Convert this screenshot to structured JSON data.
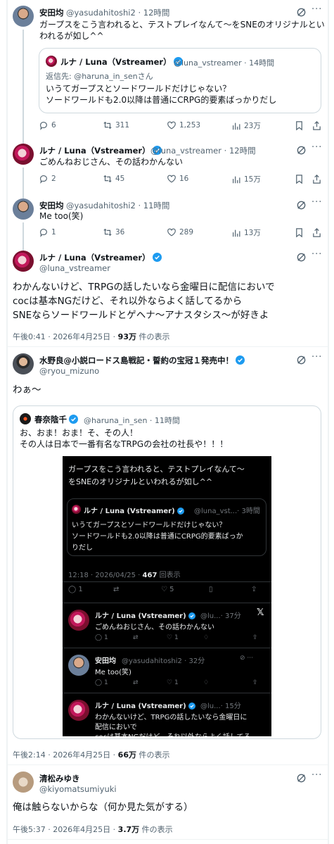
{
  "tweet1": {
    "name": "安田均",
    "handle": "@yasudahitoshi2",
    "time": "12時間",
    "text_line1": "ガープスをこう言われると、テストプレイなんて～をSNEのオリジナルとい",
    "text_line2": "われるが如し^^",
    "quote": {
      "name": "ルナ / Luna（Vstreamer）",
      "handle": "@luna_vstreamer",
      "time": "14時間",
      "reply_to": "返信先: @haruna_in_senさん",
      "text_line1": "いうてガープスとソードワールドだけじゃない？",
      "text_line2": "ソードワールドも2.0以降は普通にCRPG的要素ばっかりだし"
    },
    "replies": "6",
    "reposts": "311",
    "likes": "1,253",
    "views": "23万"
  },
  "tweet2": {
    "name": "ルナ / Luna（Vstreamer）",
    "handle": "@luna_vstreamer",
    "time": "12時間",
    "text": "ごめんねおじさん、その話わかんない",
    "replies": "2",
    "reposts": "45",
    "likes": "16",
    "views": "15万"
  },
  "tweet3": {
    "name": "安田均",
    "handle": "@yasudahitoshi2",
    "time": "11時間",
    "text": "Me too(笑)",
    "replies": "1",
    "reposts": "36",
    "likes": "289",
    "views": "13万"
  },
  "tweet4": {
    "name": "ルナ / Luna（Vstreamer）",
    "handle": "@luna_vstreamer",
    "text_line1": "わかんないけど、TRPGの話したいなら金曜日に配信においで",
    "text_line2": "cocは基本NGだけど、それ以外ならよく話してるから",
    "text_line3": "SNEならソードワールドとゲヘナ～アナスタシス～が好きよ",
    "meta_time": "午後0:41 · 2026年4月25日 · ",
    "meta_views": "93万",
    "meta_views_label": " 件の表示"
  },
  "tweet5": {
    "name": "水野良@小説ロードス島戦記・誓約の宝冠１発売中！",
    "handle": "@ryou_mizuno",
    "text": "わぁ～",
    "quote": {
      "name": "春奈陰千",
      "handle": "@haruna_in_sen",
      "time": "11時間",
      "text_line1": "お、おま！おま！そ、その人！",
      "text_line2": "その人は日本で一番有名なTRPGの会社の社長や！！！"
    },
    "meta_time": "午後2:14 · 2026年4月25日 · ",
    "meta_views": "66万",
    "meta_views_label": " 件の表示"
  },
  "screenshot": {
    "text_line1": "ガープスをこう言われると、テストプレイなんて～",
    "text_line2": "をSNEのオリジナルといわれるが如し^^",
    "q_name": "ルナ / Luna (Vstreamer)",
    "q_handle": "@luna_vst...",
    "q_time": "· 3時間",
    "q_line1": "いうてガープスとソードワールドだけじゃない？",
    "q_line2": "ソードワールドも2.0以降は普通にCRPG的要素ばっか",
    "q_line3": "りだし",
    "meta": "12:18 · 2026/04/25 · ",
    "meta_views": "467",
    "meta_views_label": " 回表示",
    "act_reply": "1",
    "act_like": "5",
    "r1_name": "ルナ / Luna (Vstreamer)",
    "r1_handle": "@lu...",
    "r1_time": "· 37分",
    "r1_text": "ごめんねおじさん、その話わかんない",
    "r1_reply": "1",
    "r1_like": "1",
    "r2_name": "安田均",
    "r2_handle": "@yasudahitoshi2",
    "r2_time": "· 32分",
    "r2_text": "Me too(笑)",
    "r2_reply": "1",
    "r2_like": "1",
    "r3_name": "ルナ / Luna (Vstreamer)",
    "r3_handle": "@lu...",
    "r3_time": "· 15分",
    "r3_line1": "わかんないけど、TRPGの話したいなら金曜日に",
    "r3_line2": "配信においで",
    "r3_line3": "cocは基本NGだけど、それ以外ならよく話してる"
  },
  "tweet6": {
    "name": "清松みゆき",
    "handle": "@kiyomatsumiyuki",
    "text": "俺は触らないからな（何か見た気がする）",
    "meta_time": "午後5:37 · 2026年4月25日 · ",
    "meta_views": "3.7万",
    "meta_views_label": " 件の表示"
  },
  "colors": {
    "accent": "#1d9bf0",
    "muted": "#536471",
    "border": "#cfd9de"
  }
}
